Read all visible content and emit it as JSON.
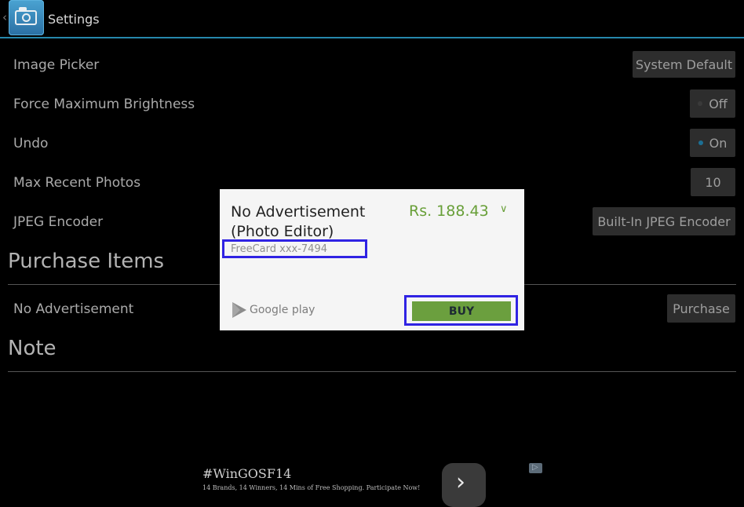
{
  "header": {
    "title": "Settings",
    "up_icon": "chevron-left-icon",
    "app_icon": "camera-icon"
  },
  "settings": [
    {
      "label": "Image Picker",
      "value": "System Default"
    },
    {
      "label": "Force Maximum Brightness",
      "value": "Off",
      "state": "off"
    },
    {
      "label": "Undo",
      "value": "On",
      "state": "on"
    },
    {
      "label": "Max Recent Photos",
      "value": "10"
    },
    {
      "label": "JPEG Encoder",
      "value": "Built-In JPEG Encoder"
    }
  ],
  "purchase": {
    "section_title": "Purchase Items",
    "item_label": "No Advertisement",
    "button_label": "Purchase"
  },
  "note": {
    "section_title": "Note"
  },
  "dialog": {
    "title": "No Advertisement (Photo Editor)",
    "price": "Rs. 188.43",
    "card": "FreeCard xxx-7494",
    "store": "Google play",
    "buy_label": "BUY"
  },
  "ad": {
    "title": "#WinGOSF14",
    "subtitle": "14 Brands, 14 Winners, 14 Mins of Free Shopping. Participate Now!",
    "next_icon": "chevron-right-icon",
    "badge_icon": "ad-choices-icon"
  },
  "colors": {
    "accent": "#33b5e5",
    "price": "#689f38",
    "buy": "#6b9f3e",
    "highlight": "#3023e3"
  }
}
